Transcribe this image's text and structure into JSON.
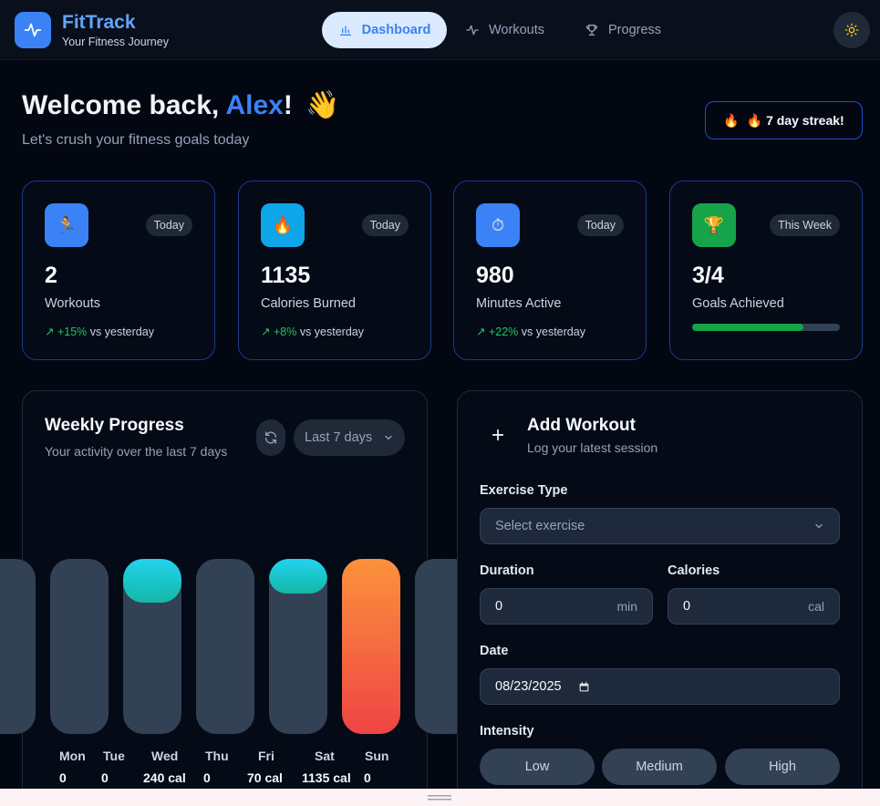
{
  "header": {
    "brand": "FitTrack",
    "tagline": "Your Fitness Journey",
    "nav": [
      {
        "label": "Dashboard",
        "active": true
      },
      {
        "label": "Workouts",
        "active": false
      },
      {
        "label": "Progress",
        "active": false
      }
    ],
    "theme_icon": "sun-icon"
  },
  "welcome": {
    "prefix": "Welcome back, ",
    "name": "Alex",
    "suffix": "!",
    "emoji": "👋",
    "subtitle": "Let's crush your fitness goals today",
    "streak_icon": "🔥",
    "streak": "🔥 7 day streak!"
  },
  "stats": [
    {
      "icon": "🏃",
      "icon_color": "#3b82f6",
      "badge": "Today",
      "value": "2",
      "label": "Workouts",
      "trend": "+15%",
      "trend_suffix": "vs yesterday",
      "trend_arrow": "↗"
    },
    {
      "icon": "🔥",
      "icon_color": "#0ea5e9",
      "badge": "Today",
      "value": "1135",
      "label": "Calories Burned",
      "trend": "+8%",
      "trend_suffix": "vs yesterday",
      "trend_arrow": "↗"
    },
    {
      "icon": "⏱",
      "icon_color": "#3b82f6",
      "badge": "Today",
      "value": "980",
      "label": "Minutes Active",
      "trend": "+22%",
      "trend_suffix": "vs yesterday",
      "trend_arrow": "↗"
    },
    {
      "icon": "🏆",
      "icon_color": "#16a34a",
      "badge": "This Week",
      "value": "3/4",
      "label": "Goals Achieved",
      "progress": 0.75
    }
  ],
  "weekly": {
    "title": "Weekly Progress",
    "subtitle": "Your activity over the last 7 days",
    "range": "Last 7 days",
    "days": [
      {
        "day": "Mon",
        "value": "0",
        "fill": 0
      },
      {
        "day": "Tue",
        "value": "0",
        "fill": 0
      },
      {
        "day": "Wed",
        "value": "240 cal",
        "fill": 0.25
      },
      {
        "day": "Thu",
        "value": "0",
        "fill": 0
      },
      {
        "day": "Fri",
        "value": "70 cal",
        "fill": 0.2
      },
      {
        "day": "Sat",
        "value": "1135 cal",
        "fill": 1
      },
      {
        "day": "Sun",
        "value": "0",
        "fill": 0
      }
    ]
  },
  "add_workout": {
    "title": "Add Workout",
    "subtitle": "Log your latest session",
    "exercise_label": "Exercise Type",
    "exercise_placeholder": "Select exercise",
    "duration_label": "Duration",
    "duration_value": "0",
    "duration_unit": "min",
    "calories_label": "Calories",
    "calories_value": "0",
    "calories_unit": "cal",
    "date_label": "Date",
    "date_value": "08/23/2025",
    "intensity_label": "Intensity",
    "intensity_options": [
      "Low",
      "Medium",
      "High"
    ]
  }
}
